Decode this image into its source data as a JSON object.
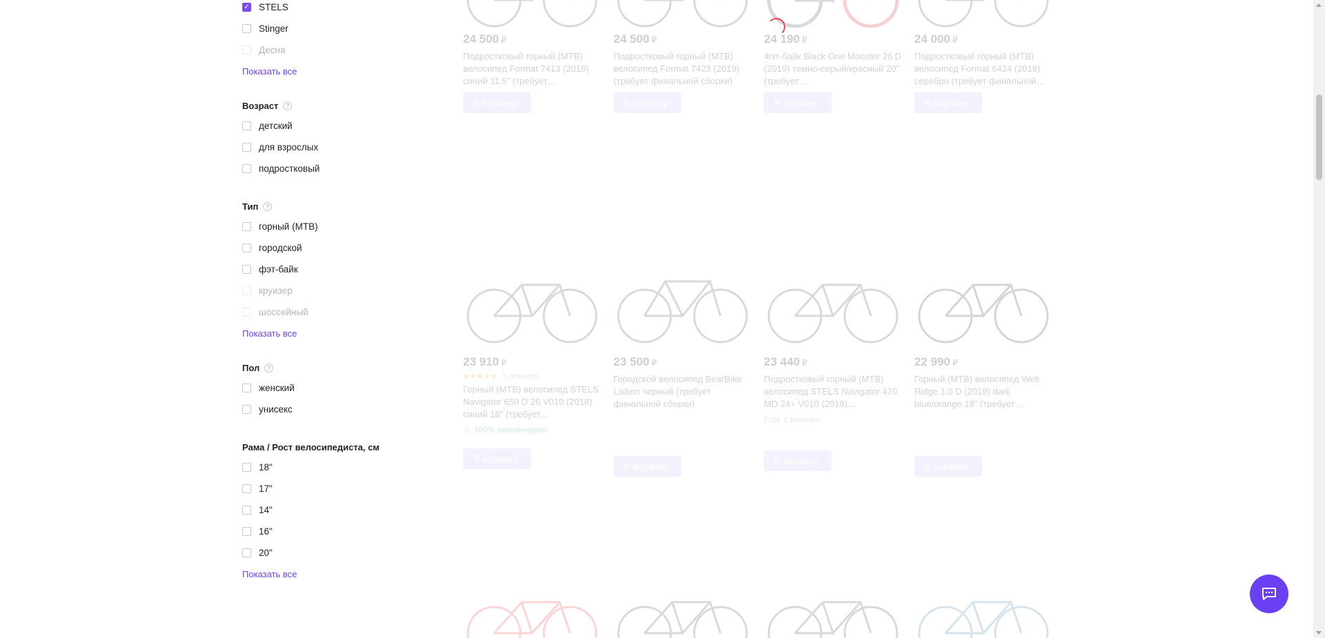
{
  "filters": {
    "brand": {
      "items": [
        {
          "label": "STELS",
          "checked": true,
          "disabled": false
        },
        {
          "label": "Stinger",
          "checked": false,
          "disabled": false
        },
        {
          "label": "Десна",
          "checked": false,
          "disabled": true
        }
      ],
      "show_all": "Показать все"
    },
    "age": {
      "title": "Возраст",
      "help": "?",
      "items": [
        {
          "label": "детский"
        },
        {
          "label": "для взрослых"
        },
        {
          "label": "подростковый"
        }
      ]
    },
    "type": {
      "title": "Тип",
      "help": "?",
      "items": [
        {
          "label": "горный (MTB)"
        },
        {
          "label": "городской"
        },
        {
          "label": "фэт-байк"
        },
        {
          "label": "круизер"
        },
        {
          "label": "шоссейный"
        }
      ],
      "show_all": "Показать все"
    },
    "gender": {
      "title": "Пол",
      "help": "?",
      "items": [
        {
          "label": "женский"
        },
        {
          "label": "унисекс"
        }
      ]
    },
    "frame": {
      "title": "Рама / Рост велосипедиста, см",
      "items": [
        {
          "label": "18\""
        },
        {
          "label": "17\""
        },
        {
          "label": "14\""
        },
        {
          "label": "16\""
        },
        {
          "label": "20\""
        }
      ],
      "show_all": "Показать все"
    }
  },
  "products": [
    {
      "price": "24 500",
      "currency": "₽",
      "title": "Подростковый горный (MTB) велосипед Format 7413 (2018) синий 11.5\" (требует…",
      "button": "В корзину"
    },
    {
      "price": "24 500",
      "currency": "₽",
      "title": "Подростковый горный (MTB) велосипед Format 7423 (2019) (требует финальной сборки)",
      "button": "В корзину"
    },
    {
      "price": "24 190",
      "currency": "₽",
      "title": "Фэт-байк Black One Monster 26 D (2019) темно-серый/красный 20\" (требует…",
      "button": "В корзину"
    },
    {
      "price": "24 000",
      "currency": "₽",
      "title": "Подростковый горный (MTB) велосипед Format 6424 (2019) серебро (требует финальной…",
      "button": "В корзину"
    },
    {
      "price": "23 910",
      "currency": "₽",
      "rating_stars": "★★★★★",
      "reviews": "5 отзывов",
      "title": "Горный (MTB) велосипед STELS Navigator 650 D 26 V010 (2018) синий 16\" (требует…",
      "recommend": "100% рекомендуют",
      "button": "В корзину"
    },
    {
      "price": "23 500",
      "currency": "₽",
      "title": "Городской велосипед BearBike Lisbon черный (требует финальной сборки)",
      "button": "В корзину"
    },
    {
      "price": "23 440",
      "currency": "₽",
      "title": "Подростковый горный (MTB) велосипед STELS Navigator 470 MD 24+ V010 (2018)…",
      "extra": "Еще 1 вариант",
      "button": "В корзину"
    },
    {
      "price": "22 990",
      "currency": "₽",
      "title": "Горный (MTB) велосипед Welt Ridge 1.0 D (2019) dark blue/orange 18\" (требует…",
      "button": "В корзину"
    }
  ],
  "colors": {
    "accent": "#6b3ff2",
    "spinner": "#f04454"
  },
  "icons": {
    "chat": "chat-icon",
    "check": "checkmark-icon"
  }
}
